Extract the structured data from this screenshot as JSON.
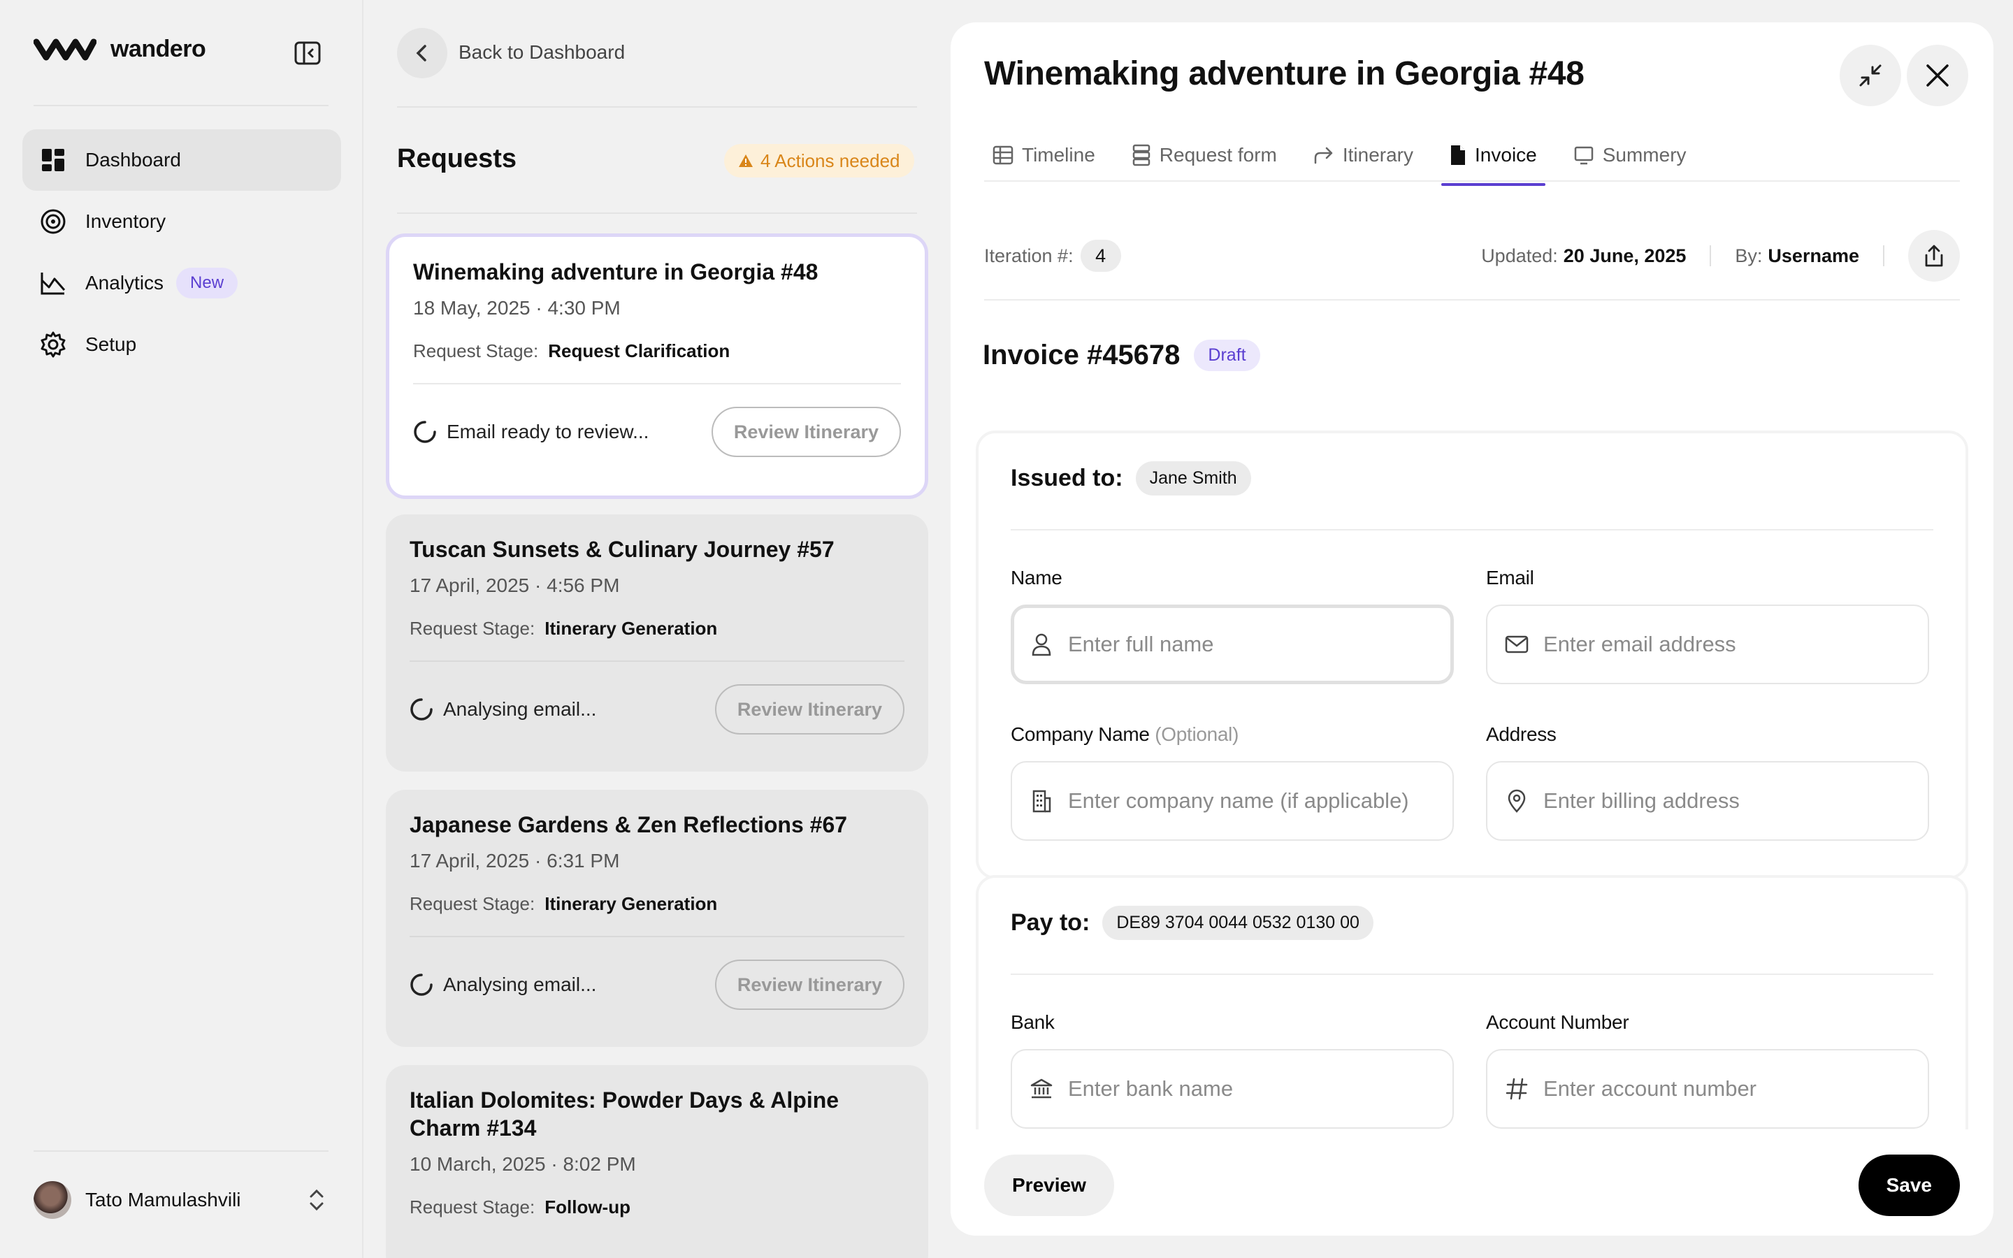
{
  "app": {
    "name": "wandero"
  },
  "sidebar": {
    "items": [
      {
        "label": "Dashboard",
        "icon": "dashboard-icon",
        "active": true
      },
      {
        "label": "Inventory",
        "icon": "inventory-icon"
      },
      {
        "label": "Analytics",
        "icon": "analytics-icon",
        "badge": "New"
      },
      {
        "label": "Setup",
        "icon": "gear-icon"
      }
    ],
    "user": {
      "name": "Tato Mamulashvili"
    }
  },
  "requests": {
    "back_label": "Back to Dashboard",
    "title": "Requests",
    "actions_badge": "4 Actions needed",
    "stage_label": "Request Stage:",
    "review_label": "Review Itinerary",
    "cards": [
      {
        "title": "Winemaking adventure in Georgia #48",
        "date": "18 May, 2025 · 4:30 PM",
        "stage": "Request Clarification",
        "status": "Email ready to review..."
      },
      {
        "title": "Tuscan Sunsets & Culinary Journey #57",
        "date": "17 April, 2025 · 4:56 PM",
        "stage": "Itinerary Generation",
        "status": "Analysing email..."
      },
      {
        "title": "Japanese Gardens & Zen Reflections #67",
        "date": "17 April, 2025 · 6:31 PM",
        "stage": "Itinerary Generation",
        "status": "Analysing email..."
      },
      {
        "title": "Italian Dolomites: Powder Days & Alpine Charm #134",
        "date": "10 March, 2025 · 8:02 PM",
        "stage": "Follow-up"
      }
    ]
  },
  "detail": {
    "title": "Winemaking adventure in Georgia #48",
    "tabs": [
      {
        "label": "Timeline",
        "icon": "table-icon"
      },
      {
        "label": "Request form",
        "icon": "form-icon"
      },
      {
        "label": "Itinerary",
        "icon": "share-arrow-icon"
      },
      {
        "label": "Invoice",
        "icon": "document-icon",
        "active": true
      },
      {
        "label": "Summery",
        "icon": "monitor-icon"
      }
    ],
    "iteration_label": "Iteration #:",
    "iteration_value": "4",
    "updated_label": "Updated:",
    "updated_value": "20 June, 2025",
    "by_label": "By:",
    "by_value": "Username",
    "invoice_title": "Invoice #45678",
    "invoice_status": "Draft",
    "issued": {
      "heading": "Issued to:",
      "chip": "Jane Smith",
      "name_label": "Name",
      "name_placeholder": "Enter full name",
      "email_label": "Email",
      "email_placeholder": "Enter email address",
      "company_label": "Company Name",
      "company_optional": "(Optional)",
      "company_placeholder": "Enter company name (if applicable)",
      "address_label": "Address",
      "address_placeholder": "Enter billing address"
    },
    "pay": {
      "heading": "Pay to:",
      "chip": "DE89 3704 0044 0532 0130 00",
      "bank_label": "Bank",
      "bank_placeholder": "Enter bank name",
      "account_label": "Account Number",
      "account_placeholder": "Enter account number"
    },
    "preview_label": "Preview",
    "save_label": "Save"
  },
  "colors": {
    "accent": "#5b3fd1",
    "warning": "#d9861a",
    "primary_button": "#000000"
  }
}
